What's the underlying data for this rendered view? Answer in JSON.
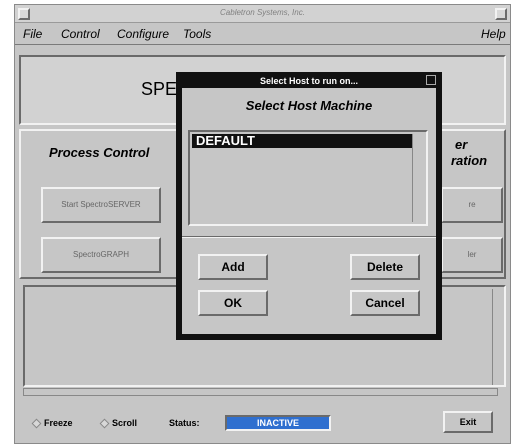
{
  "window": {
    "title": "Cabletron Systems, Inc."
  },
  "menubar": {
    "file": "File",
    "control": "Control",
    "configure": "Configure",
    "tools": "Tools",
    "help": "Help"
  },
  "banner": {
    "brand": "SPE"
  },
  "process_control": {
    "title": "Process Control",
    "start_server": "Start SpectroSERVER",
    "spectrograph": "SpectroGRAPH"
  },
  "right_panel": {
    "title_line1": "er",
    "title_line2": "ration",
    "button1": "re",
    "button2": "ler"
  },
  "statusbar": {
    "freeze": "Freeze",
    "scroll": "Scroll",
    "status_label": "Status:",
    "status_value": "INACTIVE",
    "exit": "Exit"
  },
  "dialog": {
    "title": "Select Host to run on...",
    "heading": "Select Host Machine",
    "hosts": [
      "DEFAULT"
    ],
    "add": "Add",
    "delete": "Delete",
    "ok": "OK",
    "cancel": "Cancel"
  },
  "colors": {
    "background": "#c6c6c6",
    "status_active": "#2f6fcf",
    "dialog_frame": "#111111"
  }
}
